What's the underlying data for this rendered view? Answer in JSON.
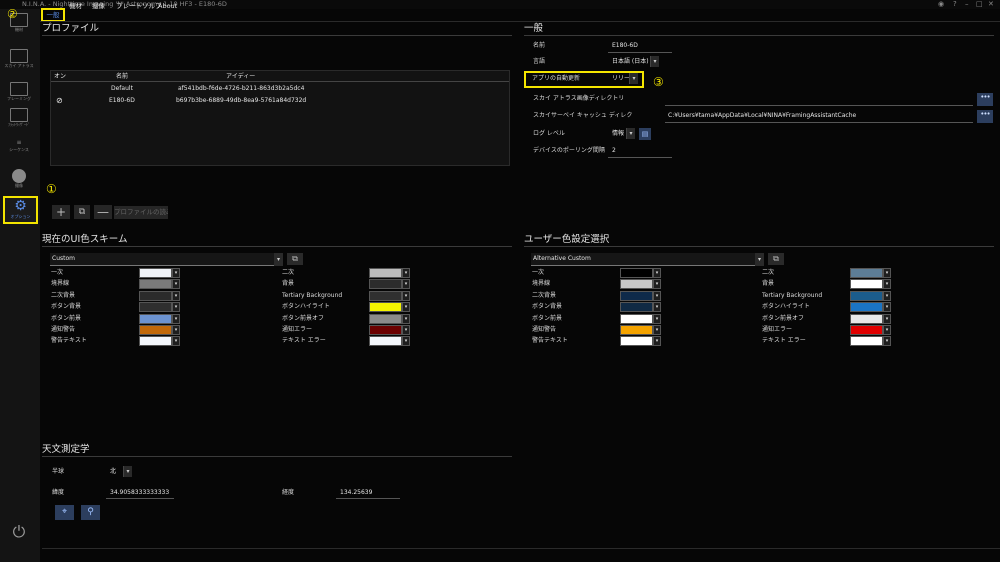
{
  "window": {
    "title": "N.I.N.A. - Nighttime Imaging 'N' Astronomy 1.10 HF3    -    E180-6D"
  },
  "sidebar": {
    "items": [
      {
        "label": "機材"
      },
      {
        "label": "スカイ アトラス"
      },
      {
        "label": "フレーミング"
      },
      {
        "label": "ﾌﾗｯﾄｳｨｻﾞｰﾄﾞ"
      },
      {
        "label": "シーケンス"
      },
      {
        "label": "撮像"
      },
      {
        "label": "オプション"
      }
    ]
  },
  "tabs": [
    {
      "label": "一般"
    },
    {
      "label": "機材"
    },
    {
      "label": "撮像"
    },
    {
      "label": "プレートソルブ"
    },
    {
      "label": "About"
    }
  ],
  "callouts": {
    "one": "①",
    "two": "②",
    "three": "③"
  },
  "profile": {
    "title": "プロファイル",
    "columns": [
      "オン",
      "名前",
      "アイディー"
    ],
    "rows": [
      {
        "active": "",
        "name": "Default",
        "id": "af541bdb-f6de-4726-b211-863d3b2a5dc4"
      },
      {
        "active": "⊘",
        "name": "E180-6D",
        "id": "b697b3be-6889-49db-8ea9-5761a84d732d"
      }
    ],
    "load_label": "プロファイルの読み"
  },
  "general": {
    "title": "一般",
    "name_label": "名前",
    "name_value": "E180-6D",
    "lang_label": "言語",
    "lang_value": "日本語 (日本)",
    "update_label": "アプリの自動更新",
    "update_value": "リリース",
    "skyatlas_label": "スカイ アトラス画像ディレクトリ",
    "skyatlas_value": "",
    "skysurvey_label": "スカイサーベイ キャッシュ ディレク",
    "skysurvey_value": "C:¥Users¥tama¥AppData¥Local¥NINA¥FramingAssistantCache",
    "loglevel_label": "ログ レベル",
    "loglevel_value": "情報",
    "polling_label": "デバイスのポーリング間隔",
    "polling_value": "2"
  },
  "ui_scheme": {
    "title": "現在のUI色スキーム",
    "selected": "Custom",
    "left": [
      {
        "label": "一次",
        "color": "#f0f3f8"
      },
      {
        "label": "境界線",
        "color": "#7a7a7a"
      },
      {
        "label": "二次背景",
        "color": "#2b2b2b"
      },
      {
        "label": "ボタン背景",
        "color": "#2f2f2f"
      },
      {
        "label": "ボタン前景",
        "color": "#6c93d0"
      },
      {
        "label": "通知警告",
        "color": "#c2690a"
      },
      {
        "label": "警告テキスト",
        "color": "#f3f6fb"
      }
    ],
    "right": [
      {
        "label": "二次",
        "color": "#bdbdbd"
      },
      {
        "label": "背景",
        "color": "#2c2c2c"
      },
      {
        "label": "Tertiary Background",
        "color": "#303030"
      },
      {
        "label": "ボタンハイライト",
        "color": "#f4f400"
      },
      {
        "label": "ボタン前景オフ",
        "color": "#8a8a8a"
      },
      {
        "label": "通知エラー",
        "color": "#6b0000"
      },
      {
        "label": "テキスト エラー",
        "color": "#f3f6fb"
      }
    ]
  },
  "user_scheme": {
    "title": "ユーザー色設定選択",
    "selected": "Alternative Custom",
    "left": [
      {
        "label": "一次",
        "color": "#000000"
      },
      {
        "label": "境界線",
        "color": "#c8c8c8"
      },
      {
        "label": "二次背景",
        "color": "#0e2a4a"
      },
      {
        "label": "ボタン背景",
        "color": "#102a44"
      },
      {
        "label": "ボタン前景",
        "color": "#ffffff"
      },
      {
        "label": "通知警告",
        "color": "#f4a300"
      },
      {
        "label": "警告テキスト",
        "color": "#ffffff"
      }
    ],
    "right": [
      {
        "label": "二次",
        "color": "#5d7d96"
      },
      {
        "label": "背景",
        "color": "#ffffff"
      },
      {
        "label": "Tertiary Background",
        "color": "#1b5c8c"
      },
      {
        "label": "ボタンハイライト",
        "color": "#1b74c4"
      },
      {
        "label": "ボタン前景オフ",
        "color": "#e8e8e8"
      },
      {
        "label": "通知エラー",
        "color": "#e00000"
      },
      {
        "label": "テキスト エラー",
        "color": "#ffffff"
      }
    ]
  },
  "astrometry": {
    "title": "天文測定学",
    "hemisphere_label": "半球",
    "hemisphere_value": "北",
    "latitude_label": "緯度",
    "latitude_value": "34.9058333333333",
    "longitude_label": "経度",
    "longitude_value": "134.25639"
  }
}
